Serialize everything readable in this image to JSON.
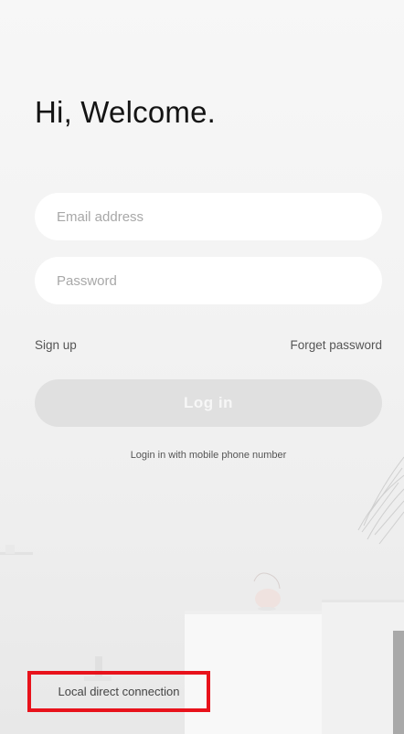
{
  "welcome": {
    "title": "Hi, Welcome."
  },
  "form": {
    "email_placeholder": "Email address",
    "password_placeholder": "Password"
  },
  "links": {
    "signup": "Sign up",
    "forget_password": "Forget password"
  },
  "login": {
    "button_label": "Log in",
    "mobile_login": "Login in with mobile phone number"
  },
  "local": {
    "label": "Local direct connection"
  },
  "colors": {
    "highlight_border": "#e8121b",
    "login_button_bg": "#e0e0e0",
    "input_bg": "#ffffff",
    "background": "#f4f4f4"
  }
}
